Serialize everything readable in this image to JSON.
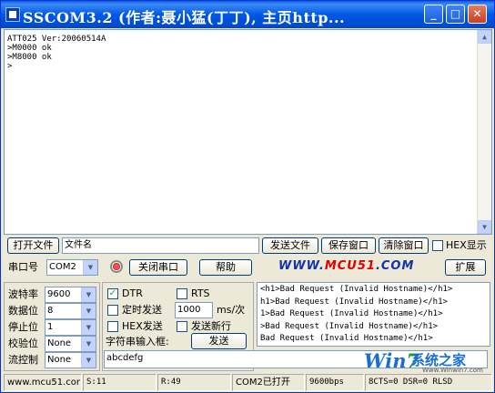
{
  "window": {
    "title": "SSCOM3.2 (作者:聂小猛(丁丁), 主页http...",
    "buttons": {
      "minimize": "_",
      "maximize": "□",
      "close": "✕"
    }
  },
  "output": {
    "lines": [
      "ATT025 Ver:20060514A",
      ">M0000 ok",
      ">M8000 ok",
      ">"
    ]
  },
  "toolbar": {
    "open_file": "打开文件",
    "file_name": "文件名",
    "send_file": "发送文件",
    "save_window": "保存窗口",
    "clear_window": "清除窗口",
    "hex_display": "HEX显示"
  },
  "port": {
    "label": "串口号",
    "value": "COM2",
    "close_port": "关闭串口",
    "help": "帮助",
    "expand": "扩展"
  },
  "logo": {
    "prefix": "WWW.",
    "brand": "MCU51",
    "suffix": ".COM"
  },
  "settings": {
    "baud_label": "波特率",
    "baud_value": "9600",
    "databits_label": "数据位",
    "databits_value": "8",
    "stopbits_label": "停止位",
    "stopbits_value": "1",
    "parity_label": "校验位",
    "parity_value": "None",
    "flow_label": "流控制",
    "flow_value": "None"
  },
  "options": {
    "dtr": "DTR",
    "dtr_checked": "✓",
    "rts": "RTS",
    "timed_send": "定时发送",
    "interval_value": "1000",
    "interval_unit": "ms/次",
    "hex_send": "HEX发送",
    "send_newline": "发送新行",
    "input_label": "字符串输入框:",
    "send": "发送",
    "input_value": "abcdefg"
  },
  "receive": {
    "lines": [
      "<h1>Bad Request (Invalid Hostname)</h1>",
      "h1>Bad Request (Invalid Hostname)</h1>",
      "1>Bad Request (Invalid Hostname)</h1>",
      ">Bad Request (Invalid Hostname)</h1>",
      "Bad Request (Invalid Hostname)</h1>"
    ]
  },
  "status": {
    "site": "www.mcu51.cor",
    "sent": "S:11",
    "received": "R:49",
    "port_state": "COM2已打开",
    "baud": "9600bps",
    "lines": "8CTS=0 DSR=0 RLSD"
  },
  "watermark": {
    "brand_w": "Win",
    "brand_7": "7",
    "brand_text": "系统之家",
    "url": "Www.Winwin7.com"
  },
  "colors": {
    "title_bar": "#0058e6",
    "logo_blue": "#1234a8",
    "logo_red": "#e00000"
  }
}
